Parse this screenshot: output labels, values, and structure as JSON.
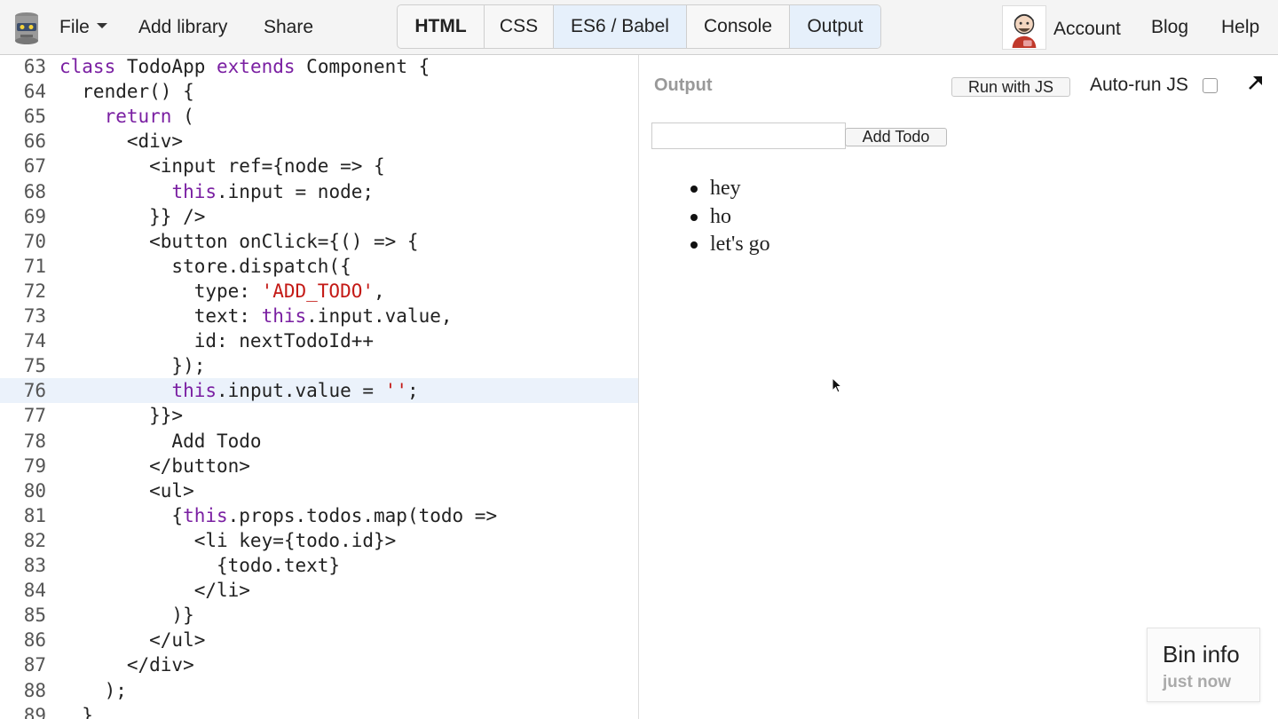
{
  "topbar": {
    "menu": {
      "file": "File",
      "add_library": "Add library",
      "share": "Share"
    },
    "tabs": [
      "HTML",
      "CSS",
      "ES6 / Babel",
      "Console",
      "Output"
    ],
    "account": "Account",
    "blog": "Blog",
    "help": "Help"
  },
  "editor": {
    "lines": [
      {
        "num": "63",
        "code": "class TodoApp extends Component {"
      },
      {
        "num": "64",
        "code": "  render() {"
      },
      {
        "num": "65",
        "code": "    return ("
      },
      {
        "num": "66",
        "code": "      <div>"
      },
      {
        "num": "67",
        "code": "        <input ref={node => {"
      },
      {
        "num": "68",
        "code": "          this.input = node;"
      },
      {
        "num": "69",
        "code": "        }} />"
      },
      {
        "num": "70",
        "code": "        <button onClick={() => {"
      },
      {
        "num": "71",
        "code": "          store.dispatch({"
      },
      {
        "num": "72",
        "code": "            type: 'ADD_TODO',"
      },
      {
        "num": "73",
        "code": "            text: this.input.value,"
      },
      {
        "num": "74",
        "code": "            id: nextTodoId++"
      },
      {
        "num": "75",
        "code": "          });"
      },
      {
        "num": "76",
        "code": "          this.input.value = '';"
      },
      {
        "num": "77",
        "code": "        }}>"
      },
      {
        "num": "78",
        "code": "          Add Todo"
      },
      {
        "num": "79",
        "code": "        </button>"
      },
      {
        "num": "80",
        "code": "        <ul>"
      },
      {
        "num": "81",
        "code": "          {this.props.todos.map(todo =>"
      },
      {
        "num": "82",
        "code": "            <li key={todo.id}>"
      },
      {
        "num": "83",
        "code": "              {todo.text}"
      },
      {
        "num": "84",
        "code": "            </li>"
      },
      {
        "num": "85",
        "code": "          )}"
      },
      {
        "num": "86",
        "code": "        </ul>"
      },
      {
        "num": "87",
        "code": "      </div>"
      },
      {
        "num": "88",
        "code": "    );"
      },
      {
        "num": "89",
        "code": "  }"
      }
    ],
    "highlighted_line": "76"
  },
  "output": {
    "label": "Output",
    "run_button": "Run with JS",
    "autorun_label": "Auto-run JS",
    "autorun_checked": false,
    "add_button": "Add Todo",
    "input_value": "",
    "todos": [
      "hey",
      "ho",
      "let's go"
    ]
  },
  "bin_info": {
    "title": "Bin info",
    "subtitle": "just now"
  },
  "colors": {
    "keyword": "#7a1fa2",
    "string": "#c41a16",
    "active_tab_bg": "#e6f0fb",
    "highlight_line_bg": "#ebf2fb"
  }
}
